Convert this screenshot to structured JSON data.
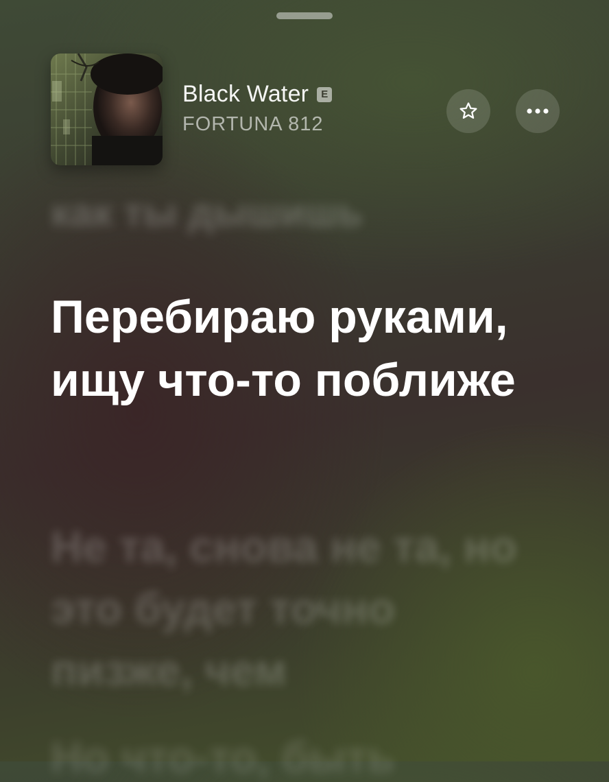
{
  "track": {
    "title": "Black Water",
    "explicit_label": "E",
    "artist": "FORTUNA 812"
  },
  "lyrics": {
    "previous": "как ты дышишь",
    "current": "Перебираю руками, ищу что-то поближе",
    "next": "Не та, снова не та, но это будет точно пизже, чем",
    "after": "Но что-то, быть"
  },
  "icons": {
    "favorite": "star-icon",
    "more": "ellipsis-icon"
  },
  "colors": {
    "lyric_active": "#ffffff",
    "background_green": "#45502c",
    "background_brown": "#3a302d"
  }
}
